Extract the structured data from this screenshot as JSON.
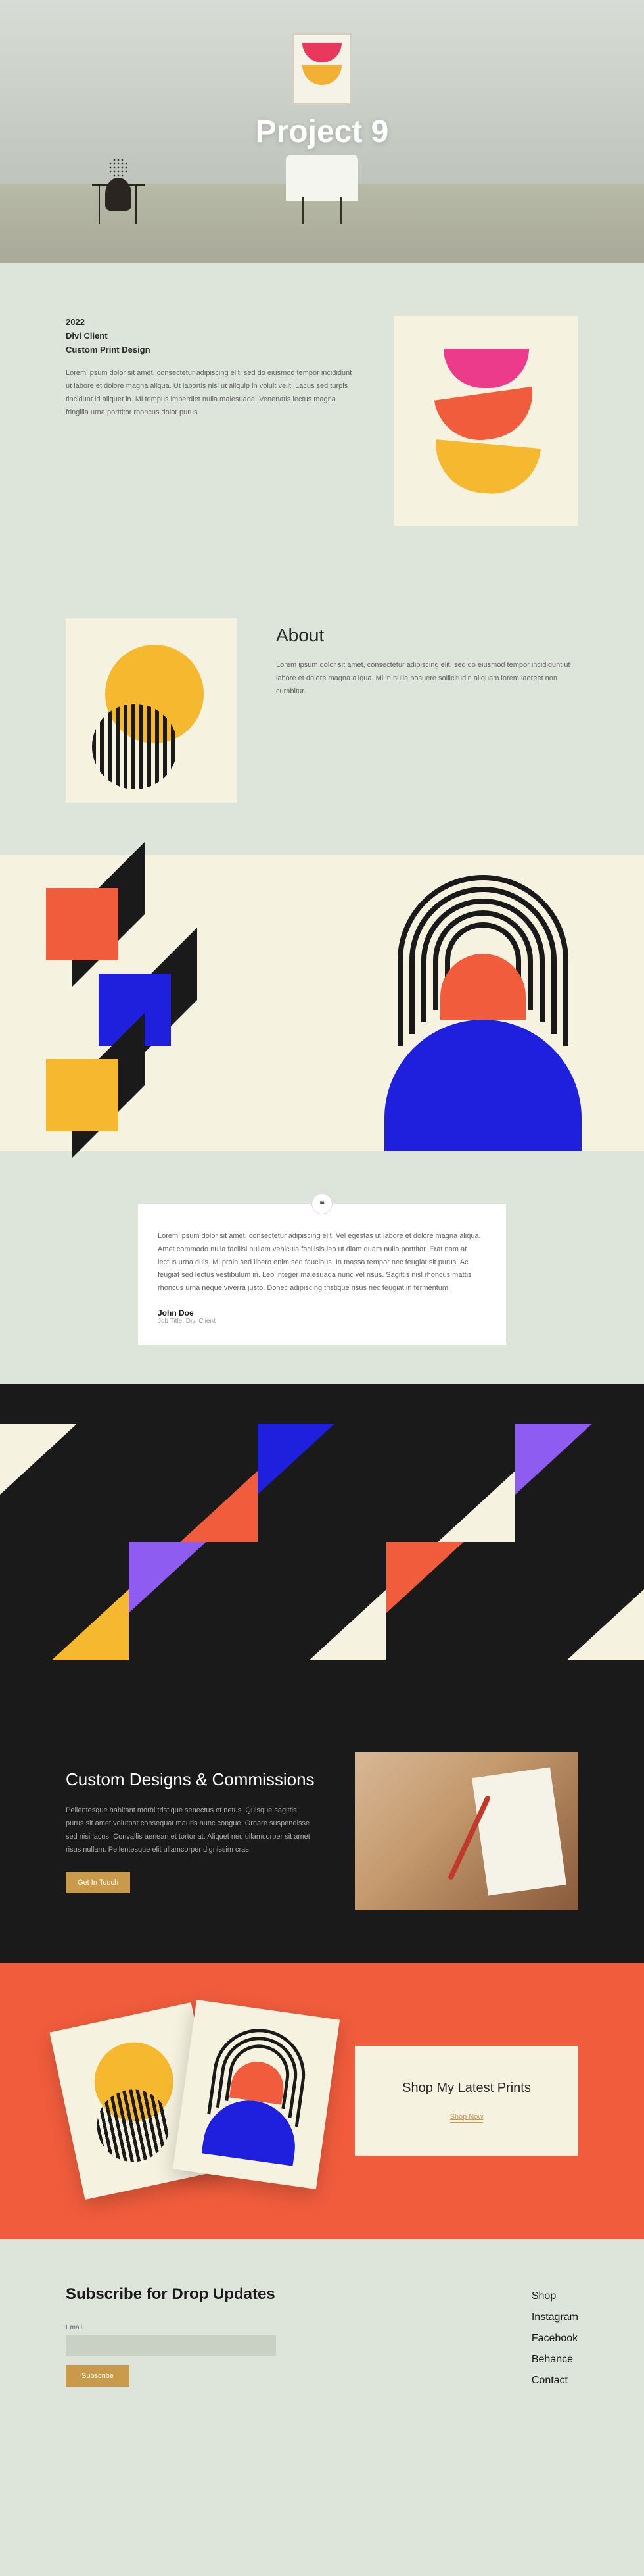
{
  "hero": {
    "title": "Project 9"
  },
  "intro": {
    "year": "2022",
    "client": "Divi Client",
    "service": "Custom Print Design",
    "body": "Lorem ipsum dolor sit amet, consectetur adipiscing elit, sed do eiusmod tempor incididunt ut labore et dolore magna aliqua. Ut labortis nisl ut aliquip in voluit velit. Lacus sed turpis tincidunt id aliquet in. Mi tempus imperdiet nulla malesuada. Venenatis lectus magna fringilla urna porttitor rhoncus dolor purus."
  },
  "about": {
    "title": "About",
    "body": "Lorem ipsum dolor sit amet, consectetur adipiscing elit, sed do eiusmod tempor incididunt ut labore et dolore magna aliqua. Mi in nulla posuere sollicitudin aliquam lorem laoreet non curabitur."
  },
  "testimonial": {
    "body": "Lorem ipsum dolor sit amet, consectetur adipiscing elit. Vel egestas ut labore et dolore magna aliqua. Amet commodo nulla facilisi nullam vehicula facilisis leo ut diam quam nulla porttitor. Erat nam at lectus urna duis. Mi proin sed libero enim sed faucibus. In massa tempor nec feugiat sit purus. Ac feugiat sed lectus vestibulum in. Leo integer malesuada nunc vel risus. Sagittis nisl rhoncus mattis rhoncus urna neque viverra justo. Donec adipiscing tristique risus nec feugiat in fermentum.",
    "author": "John Doe",
    "role": "Job Title, Divi Client"
  },
  "commissions": {
    "title": "Custom Designs & Commissions",
    "body": "Pellentesque habitant morbi tristique senectus et netus. Quisque sagittis purus sit amet volutpat consequat mauris nunc congue. Ornare suspendisse sed nisi lacus. Convallis aenean et tortor at. Aliquet nec ullamcorper sit amet risus nullam. Pellentesque elit ullamcorper dignissim cras.",
    "button": "Get In Touch"
  },
  "shop": {
    "title": "Shop My Latest Prints",
    "button": "Shop Now"
  },
  "footer": {
    "title": "Subscribe for Drop Updates",
    "email_label": "Email",
    "button": "Subscribe",
    "links": [
      "Shop",
      "Instagram",
      "Facebook",
      "Behance",
      "Contact"
    ]
  }
}
